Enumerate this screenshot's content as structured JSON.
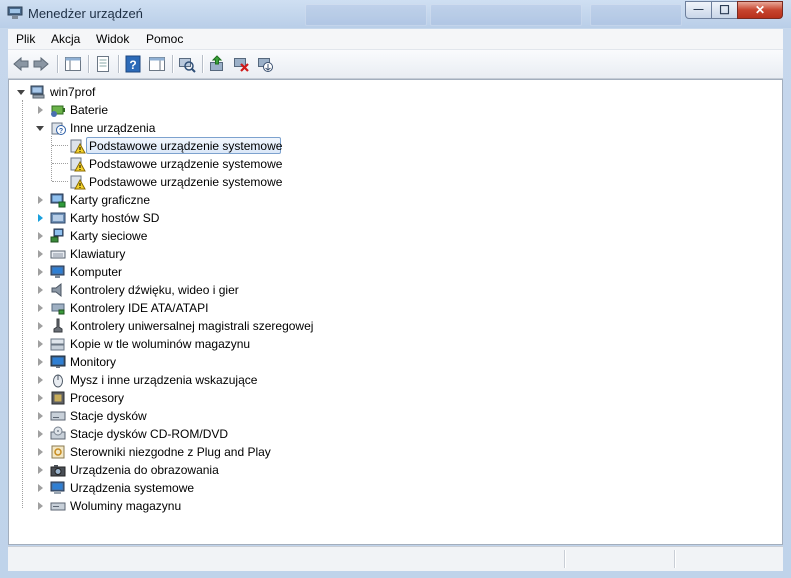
{
  "window": {
    "title": "Menedżer urządzeń",
    "controls": {
      "minimize": "—",
      "maximize": "☐",
      "close": "✕"
    }
  },
  "menu": [
    "Plik",
    "Akcja",
    "Widok",
    "Pomoc"
  ],
  "toolbar": {
    "buttons": [
      "back-arrow-icon",
      "forward-arrow-icon",
      "show-hide-console-tree-icon",
      "properties-icon",
      "help-icon",
      "action-pane-icon",
      "scan-hardware-icon",
      "update-driver-icon",
      "uninstall-icon",
      "disable-device-icon"
    ]
  },
  "tree": {
    "root": "win7prof",
    "categories": [
      {
        "label": "Baterie",
        "icon": "battery-icon",
        "expanded": false
      },
      {
        "label": "Inne urządzenia",
        "icon": "unknown-device-icon",
        "expanded": true,
        "children": [
          {
            "label": "Podstawowe urządzenie systemowe",
            "icon": "warning-device-icon",
            "selected": true
          },
          {
            "label": "Podstawowe urządzenie systemowe",
            "icon": "warning-device-icon"
          },
          {
            "label": "Podstawowe urządzenie systemowe",
            "icon": "warning-device-icon"
          }
        ]
      },
      {
        "label": "Karty graficzne",
        "icon": "display-adapter-icon"
      },
      {
        "label": "Karty hostów SD",
        "icon": "sd-host-icon"
      },
      {
        "label": "Karty sieciowe",
        "icon": "network-adapter-icon"
      },
      {
        "label": "Klawiatury",
        "icon": "keyboard-icon"
      },
      {
        "label": "Komputer",
        "icon": "computer-icon"
      },
      {
        "label": "Kontrolery dźwięku, wideo i gier",
        "icon": "speaker-icon"
      },
      {
        "label": "Kontrolery IDE ATA/ATAPI",
        "icon": "ide-controller-icon"
      },
      {
        "label": "Kontrolery uniwersalnej magistrali szeregowej",
        "icon": "usb-icon"
      },
      {
        "label": "Kopie w tle woluminów magazynu",
        "icon": "volume-shadow-icon"
      },
      {
        "label": "Monitory",
        "icon": "monitor-icon"
      },
      {
        "label": "Mysz i inne urządzenia wskazujące",
        "icon": "mouse-icon"
      },
      {
        "label": "Procesory",
        "icon": "processor-icon"
      },
      {
        "label": "Stacje dysków",
        "icon": "disk-drive-icon"
      },
      {
        "label": "Stacje dysków CD-ROM/DVD",
        "icon": "cdrom-icon"
      },
      {
        "label": "Sterowniki niezgodne z Plug and Play",
        "icon": "non-pnp-driver-icon"
      },
      {
        "label": "Urządzenia do obrazowania",
        "icon": "camera-icon"
      },
      {
        "label": "Urządzenia systemowe",
        "icon": "system-devices-icon"
      },
      {
        "label": "Woluminy magazynu",
        "icon": "storage-volume-icon"
      }
    ]
  },
  "status_bar": {
    "sections": [
      "",
      "",
      ""
    ]
  }
}
